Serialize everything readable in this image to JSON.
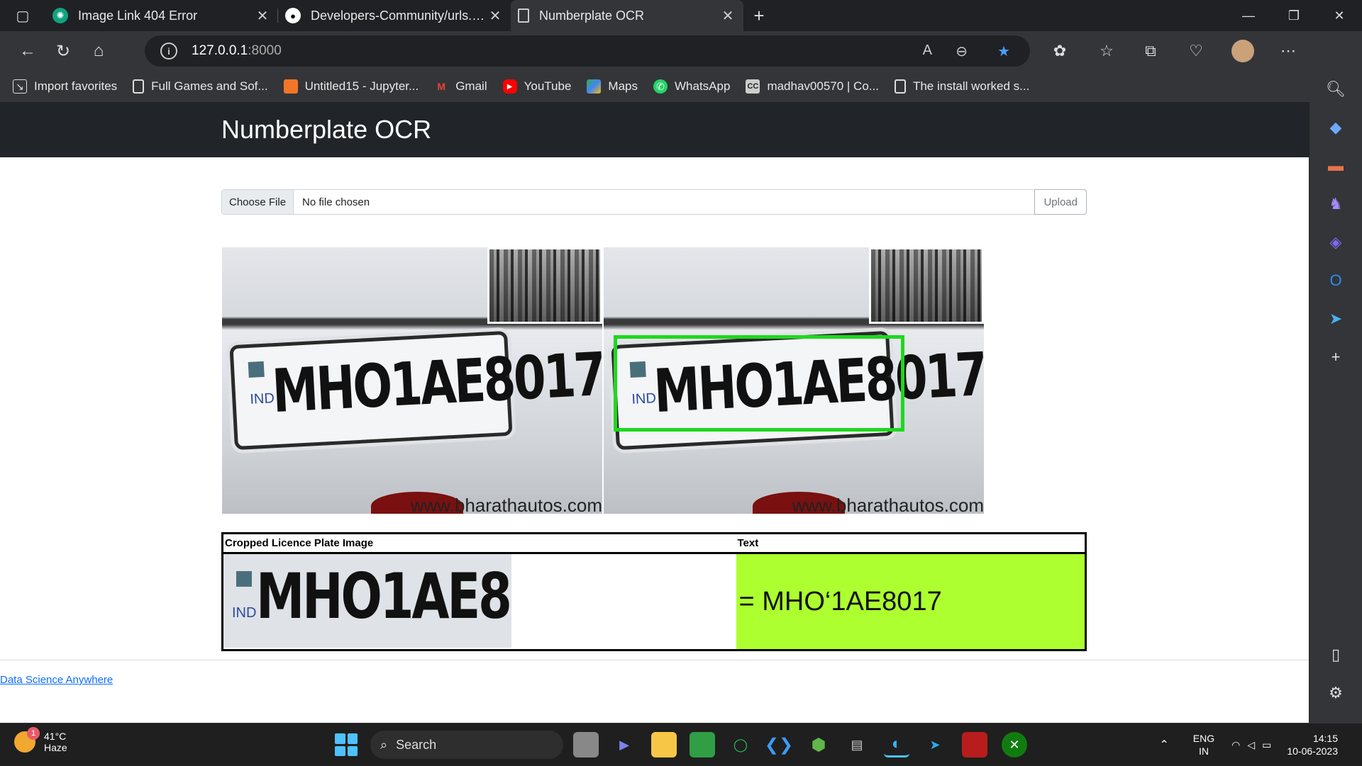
{
  "browser": {
    "tabs": [
      {
        "title": "Image Link 404 Error",
        "icon": "chatgpt-icon"
      },
      {
        "title": "Developers-Community/urls.py at",
        "icon": "github-icon"
      },
      {
        "title": "Numberplate OCR",
        "icon": "page-icon"
      }
    ],
    "address": {
      "host": "127.0.0.1",
      "port": ":8000"
    },
    "bookmarks": [
      {
        "label": "Import favorites",
        "icon": "import-icon",
        "color": "#dddddd"
      },
      {
        "label": "Full Games and Sof...",
        "icon": "page-icon",
        "color": "#dddddd"
      },
      {
        "label": "Untitled15 - Jupyter...",
        "icon": "jupyter-icon",
        "color": "#f37626"
      },
      {
        "label": "Gmail",
        "icon": "gmail-icon",
        "color": "#ea4335"
      },
      {
        "label": "YouTube",
        "icon": "youtube-icon",
        "color": "#ff0000"
      },
      {
        "label": "Maps",
        "icon": "maps-icon",
        "color": "#34a853"
      },
      {
        "label": "WhatsApp",
        "icon": "whatsapp-icon",
        "color": "#25d366"
      },
      {
        "label": "madhav00570 | Co...",
        "icon": "cc-icon",
        "color": "#cccccc"
      },
      {
        "label": "The install worked s...",
        "icon": "page-icon",
        "color": "#dddddd"
      }
    ]
  },
  "app": {
    "brand": "Numberplate OCR",
    "form": {
      "choose_label": "Choose File",
      "file_status": "No file chosen",
      "upload_label": "Upload"
    },
    "images": {
      "plate_text": "MHO1AE8017",
      "ind": "IND",
      "watermark": "www.bharathautos.com"
    },
    "table": {
      "headers": [
        "Cropped Licence Plate Image",
        "Text"
      ],
      "ocr_text": "= MHO‘1AE8017",
      "highlight_color": "#adff2f",
      "bbox_color": "#1ed81e"
    },
    "footer_link": "Data Science Anywhere"
  },
  "taskbar": {
    "temperature": "41°C",
    "condition": "Haze",
    "notification_count": "1",
    "search_placeholder": "Search",
    "lang_top": "ENG",
    "lang_bottom": "IN",
    "time": "14:15",
    "date": "10-06-2023"
  }
}
